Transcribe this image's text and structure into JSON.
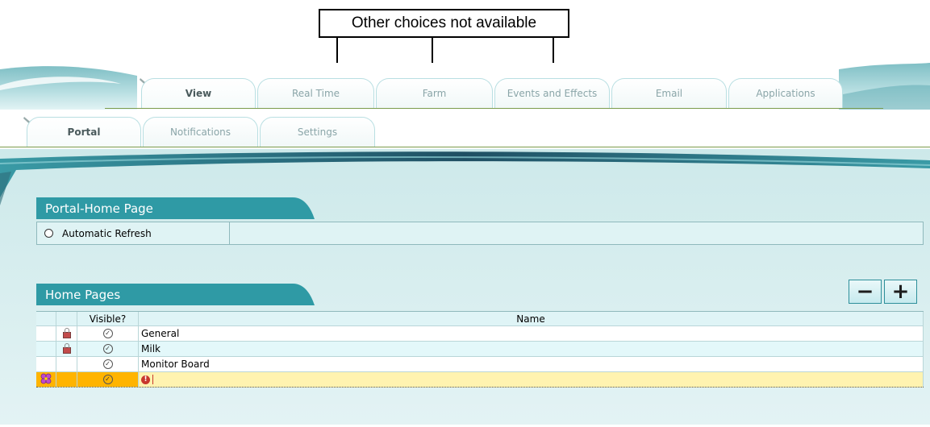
{
  "annotation": {
    "text": "Other choices not available"
  },
  "top_tabs": [
    {
      "label": "View",
      "active": true
    },
    {
      "label": "Real Time",
      "active": false
    },
    {
      "label": "Farm",
      "active": false
    },
    {
      "label": "Events and Effects",
      "active": false
    },
    {
      "label": "Email",
      "active": false
    },
    {
      "label": "Applications",
      "active": false
    }
  ],
  "sub_tabs": [
    {
      "label": "Portal",
      "active": true
    },
    {
      "label": "Notifications",
      "active": false
    },
    {
      "label": "Settings",
      "active": false
    }
  ],
  "portal_section": {
    "title": "Portal-Home Page",
    "refresh_label": "Automatic Refresh"
  },
  "home_pages": {
    "title": "Home Pages",
    "remove_glyph": "−",
    "add_glyph": "+",
    "columns": [
      "Visible?",
      "Name"
    ],
    "rows": [
      {
        "name": "General",
        "locked": true,
        "visible": true
      },
      {
        "name": "Milk",
        "locked": true,
        "visible": true
      },
      {
        "name": "Monitor Board",
        "locked": false,
        "visible": true
      },
      {
        "name": "",
        "locked": false,
        "visible": true,
        "editing": true
      }
    ]
  },
  "colors": {
    "teal": "#2f9aa5",
    "edit_row": "#fff3b0",
    "edit_marker": "#ffb400"
  }
}
